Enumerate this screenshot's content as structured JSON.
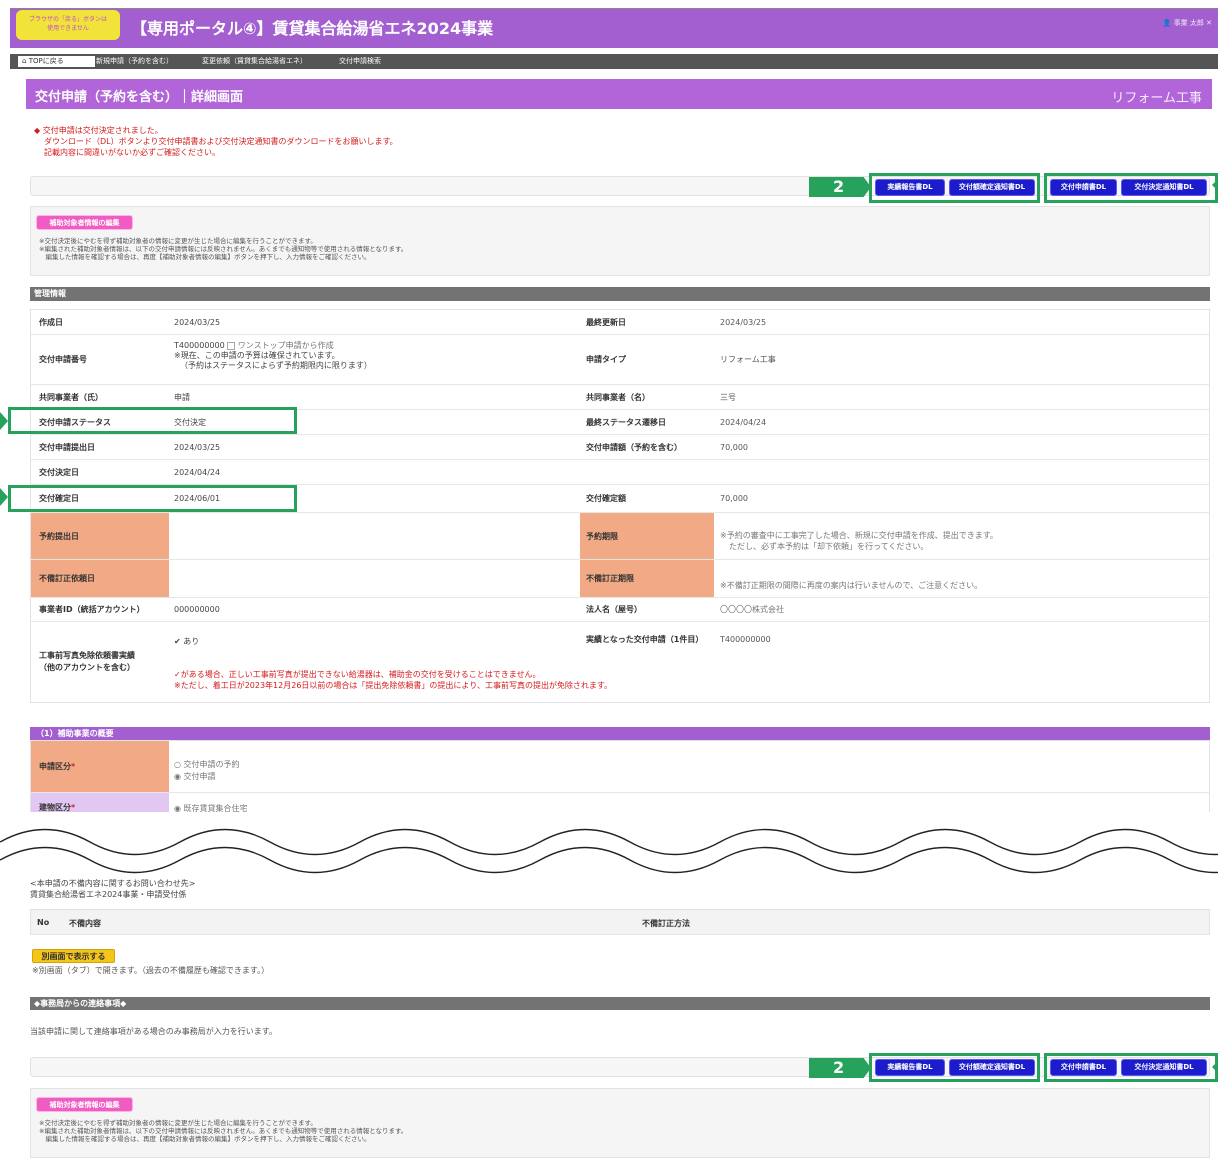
{
  "header": {
    "browser_note": "ブラウザの「戻る」ボタンは\n使用できません",
    "portal_title": "【専用ポータル④】賃貸集合給湯省エネ2024事業",
    "user_name": "事業 太郎"
  },
  "nav": {
    "top": "TOPに戻る",
    "items": [
      "新規申請（予約を含む）",
      "変更依頼（賃貸集合給湯省エネ）",
      "交付申請検索"
    ]
  },
  "page": {
    "title": "交付申請（予約を含む）｜詳細画面",
    "type_label": "リフォーム工事"
  },
  "notice": {
    "line1": "◆ 交付申請は交付決定されました。",
    "line2": "ダウンロード（DL）ボタンより交付申請書および交付決定通知書のダウンロードをお願いします。",
    "line3": "記載内容に間違いがないか必ずご確認ください。"
  },
  "buttons": {
    "marker": "2",
    "report_dl": "実績報告書DL",
    "amount_notice_dl": "交付額確定通知書DL",
    "application_dl": "交付申請書DL",
    "decision_notice_dl": "交付決定通知書DL",
    "edit_subject": "補助対象者情報の編集",
    "open_tab": "別画面で表示する"
  },
  "edit_notes": "※交付決定後にやむを得ず補助対象者の情報に変更が生じた場合に編集を行うことができます。\n※編集された補助対象者情報は、以下の交付申請情報には反映されません。あくまでも通知物等で使用される情報となります。\n　編集した情報を確認する場合は、再度【補助対象者情報の編集】ボタンを押下し、入力情報をご確認ください。",
  "management": {
    "title": "管理情報",
    "created_label": "作成日",
    "created_value": "2024/03/25",
    "updated_label": "最終更新日",
    "updated_value": "2024/03/25",
    "app_no_label": "交付申請番号",
    "app_no_value": "T400000000",
    "onestop": "ワンストップ申請から作成",
    "budget_note1": "※現在、この申請の予算は確保されています。",
    "budget_note2": "（予約はステータスによらず予約期限内に限ります）",
    "type_label": "申請タイプ",
    "type_value": "リフォーム工事",
    "co_last_label": "共同事業者（氏）",
    "co_last_value": "申請",
    "co_first_label": "共同事業者（名）",
    "co_first_value": "三号",
    "status_label": "交付申請ステータス",
    "status_value": "交付決定",
    "status_date_label": "最終ステータス遷移日",
    "status_date_value": "2024/04/24",
    "submit_label": "交付申請提出日",
    "submit_value": "2024/03/25",
    "amount_label": "交付申請額（予約を含む）",
    "amount_value": "70,000",
    "decision_label": "交付決定日",
    "decision_value": "2024/04/24",
    "confirm_label": "交付確定日",
    "confirm_value": "2024/06/01",
    "confirm_amount_label": "交付確定額",
    "confirm_amount_value": "70,000",
    "reserve_label": "予約提出日",
    "reserve_deadline_label": "予約期限",
    "reserve_note1": "※予約の審査中に工事完了した場合、新規に交付申請を作成、提出できます。",
    "reserve_note2": "ただし、必ず本予約は「却下依頼」を行ってください。",
    "fix_request_label": "不備訂正依頼日",
    "fix_deadline_label": "不備訂正期限",
    "fix_note": "※不備訂正期限の間際に再度の案内は行いませんので、ご注意ください。",
    "biz_id_label": "事業者ID（統括アカウント）",
    "biz_id_value": "000000000",
    "corp_label": "法人名（屋号）",
    "corp_value": "〇〇〇〇株式会社",
    "photo_label": "工事前写真免除依頼書実績\n（他のアカウントを含む）",
    "photo_value": "あり",
    "result_label": "実績となった交付申請（1件目）",
    "result_value": "T400000000",
    "photo_warn1": "✓がある場合、正しい工事前写真が提出できない給湯器は、補助金の交付を受けることはできません。",
    "photo_warn2": "※ただし、着工日が2023年12月26日以前の場合は「提出免除依頼書」の提出により、工事前写真の提出が免除されます。"
  },
  "summary": {
    "title": "（1）補助事業の概要",
    "category_label": "申請区分",
    "required": "*",
    "option1": "交付申請の予約",
    "option2": "交付申請",
    "building_label": "建物区分",
    "building_value": "既存賃貸集合住宅"
  },
  "contact": "<本申請の不備内容に関するお問い合わせ先>\n賃貸集合給湯省エネ2024事業・申請受付係",
  "defects": {
    "no": "No",
    "content": "不備内容",
    "method": "不備訂正方法"
  },
  "tab_note": "※別画面（タブ）で開きます。（過去の不備履歴も確認できます。）",
  "office": {
    "title": "◆事務局からの連絡事項◆",
    "note": "当該申請に関して連絡事項がある場合のみ事務局が入力を行います。"
  },
  "colors": {
    "purple": "#a35fd0",
    "green": "#27a25d",
    "blue": "#1c1ccc",
    "pink": "#ef5cc2",
    "orange": "#f2a985"
  }
}
